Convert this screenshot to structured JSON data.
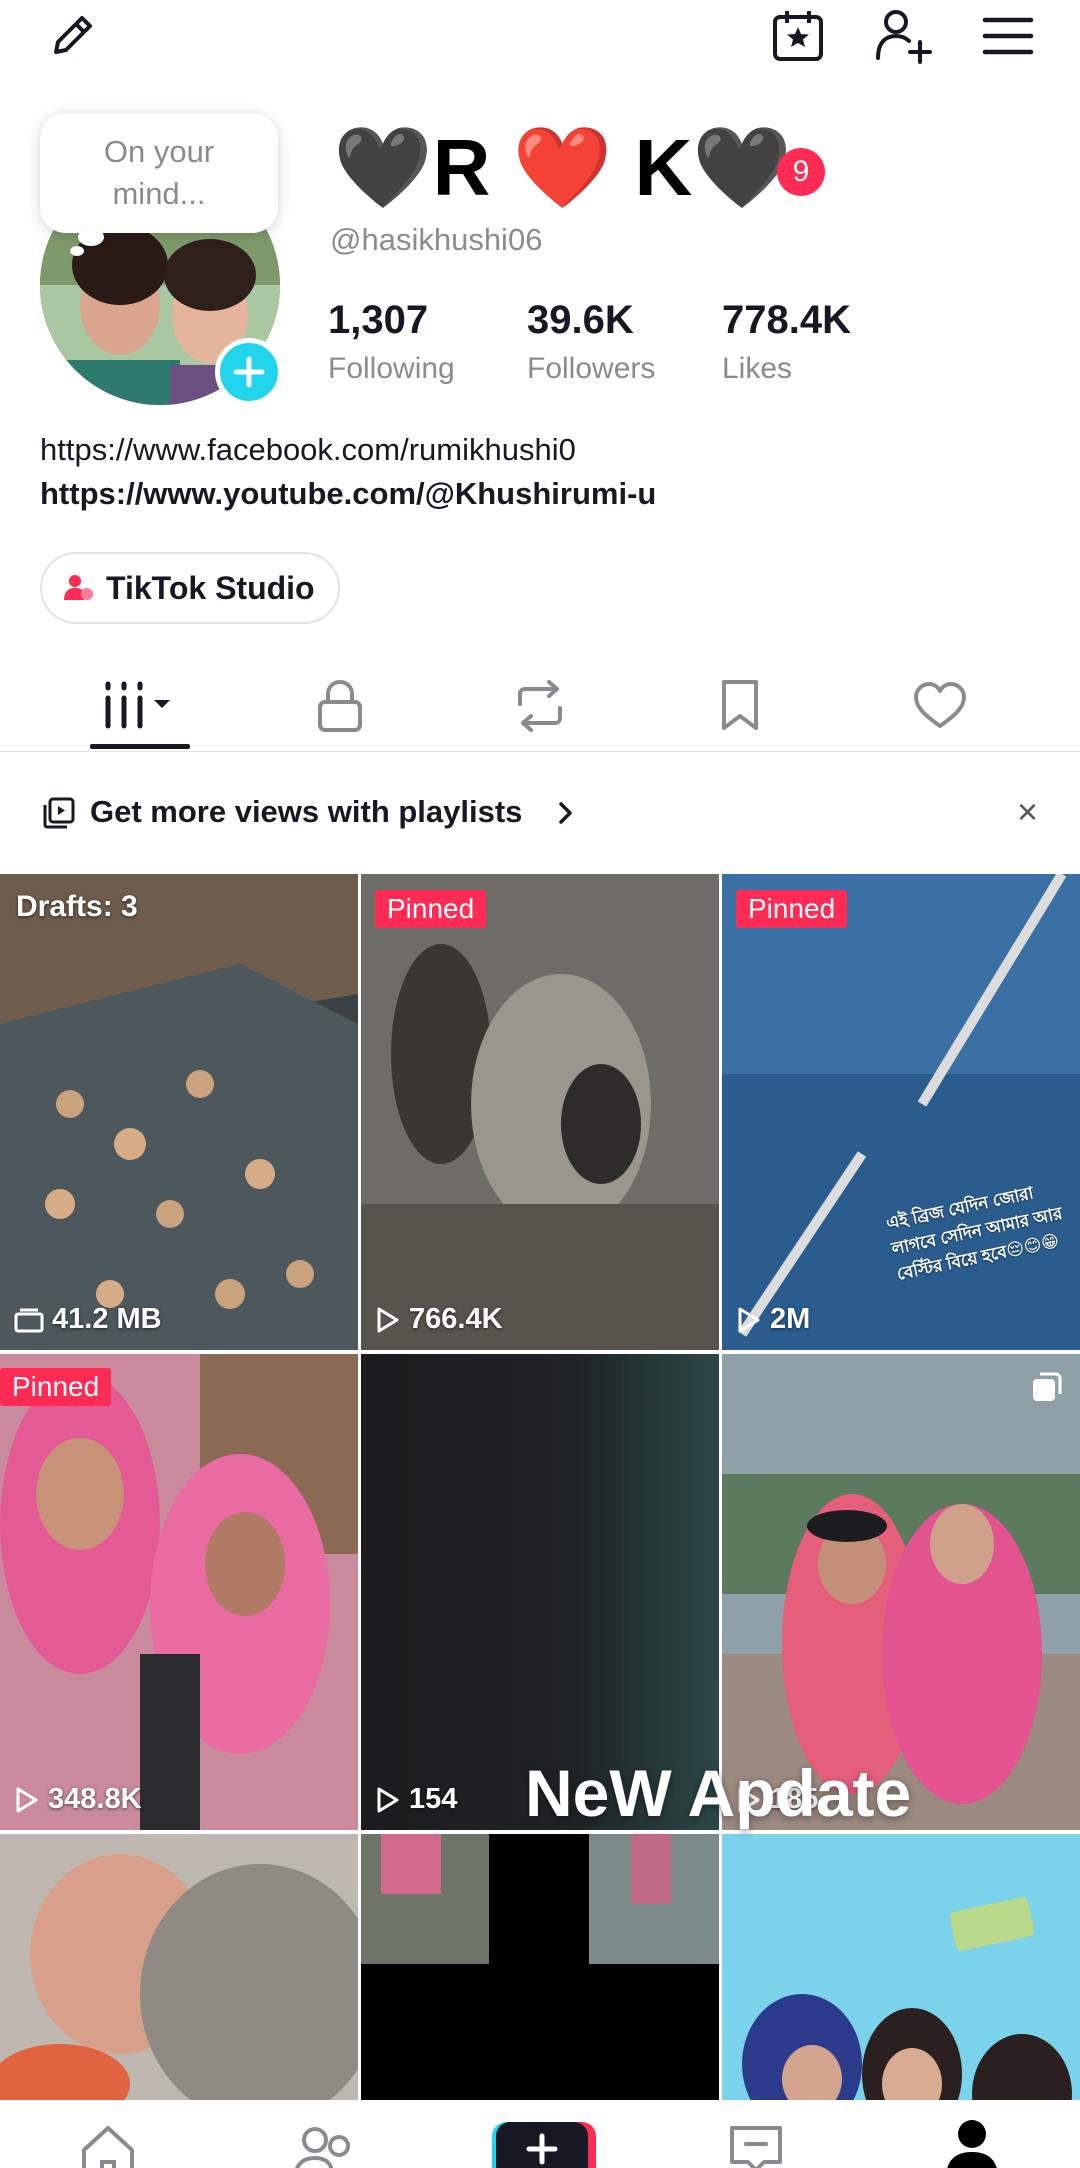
{
  "header": {
    "edit_icon": "pencil-icon",
    "calendar_icon": "calendar-star-icon",
    "add_friend_icon": "add-user-icon",
    "menu_icon": "hamburger-menu-icon"
  },
  "profile": {
    "note_bubble": "On your mind...",
    "display_name": "🖤R ❤️ K🖤",
    "name_badge": "9",
    "username": "@hasikhushi06",
    "stats": [
      {
        "value": "1,307",
        "label": "Following"
      },
      {
        "value": "39.6K",
        "label": "Followers"
      },
      {
        "value": "778.4K",
        "label": "Likes"
      }
    ],
    "links": [
      "https://www.facebook.com/rumikhushi0",
      "https://www.youtube.com/@Khushirumi-u"
    ],
    "studio_button": "TikTok Studio"
  },
  "tabs": [
    {
      "icon": "videos-grid-icon",
      "active": true
    },
    {
      "icon": "lock-icon"
    },
    {
      "icon": "repost-icon"
    },
    {
      "icon": "bookmark-icon"
    },
    {
      "icon": "heart-icon"
    }
  ],
  "promo": {
    "text": "Get more views with playlists",
    "close": "×"
  },
  "grid": {
    "items": [
      {
        "top_label": "Drafts: 3",
        "stat": "41.2 MB"
      },
      {
        "badge": "Pinned",
        "stat": "766.4K"
      },
      {
        "badge": "Pinned",
        "stat": "2M",
        "caption": "এই ব্রিজ যেদিন জোরা লাগবে সেদিন আমার আর বেস্টির বিয়ে হবে😔😊😁"
      },
      {
        "badge": "Pinned",
        "stat": "348.8K"
      },
      {
        "stat": "154"
      },
      {
        "stat": "185"
      },
      {},
      {},
      {}
    ],
    "overlay_text": "NeW Apdate"
  },
  "bottom_nav": [
    {
      "icon": "home-icon"
    },
    {
      "icon": "friends-icon"
    },
    {
      "icon": "create-plus-icon"
    },
    {
      "icon": "inbox-icon"
    },
    {
      "icon": "profile-icon"
    }
  ],
  "colors": {
    "accent": "#fe2c55",
    "cyan": "#20d5ec",
    "text": "#161823",
    "muted": "#8a8b91"
  }
}
